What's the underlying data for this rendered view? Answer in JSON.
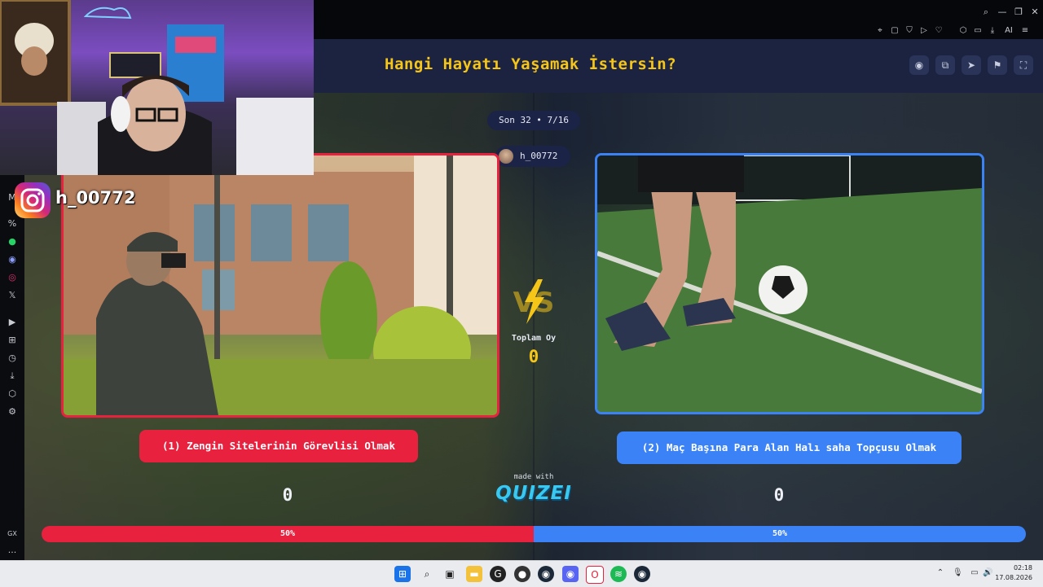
{
  "header": {
    "title": "Hangi Hayatı Yaşamak İstersin?",
    "buttons": [
      "eye-icon",
      "share-icon",
      "send-icon",
      "flag-icon",
      "fullscreen-icon"
    ]
  },
  "round": {
    "progress": "Son 32 • 7/16",
    "username": "h_00772"
  },
  "totals": {
    "label": "Toplam Oy",
    "value": "0",
    "vs": "VS"
  },
  "options": [
    {
      "label": "(1) Zengin Sitelerinin Görevlisi Olmak",
      "votes": "0",
      "percent_label": "50%",
      "percent": 50,
      "color": "#e8213e"
    },
    {
      "label": "(2) Maç Başına Para Alan Halı saha Topçusu Olmak",
      "votes": "0",
      "percent_label": "50%",
      "percent": 50,
      "color": "#3b82f6"
    }
  ],
  "branding": {
    "made_with": "made with",
    "logo": "QUIZEI"
  },
  "stream_overlay": {
    "instagram_handle": "h_00772"
  },
  "browser": {
    "sidebar_label_gx": "GX",
    "sidebar_more": "..."
  },
  "taskbar": {
    "time": "02:18",
    "date": "17.08.2026"
  },
  "colors": {
    "accent": "#f5c518",
    "header_bg": "#1c2340",
    "red": "#e8213e",
    "blue": "#3b82f6"
  }
}
